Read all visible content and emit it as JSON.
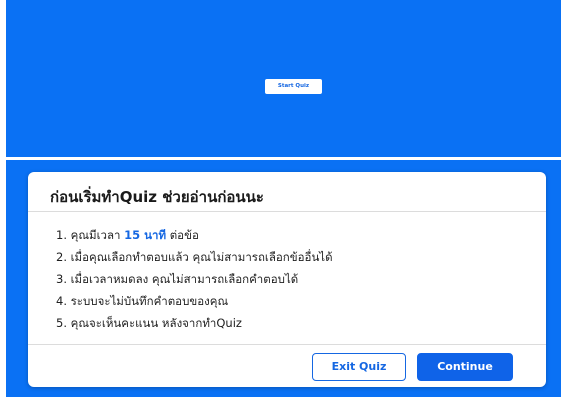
{
  "start_screen": {
    "start_button_label": "Start Quiz"
  },
  "dialog": {
    "title": "ก่อนเริ่มทำQuiz ช่วยอ่านก่อนนะ",
    "rules": [
      {
        "prefix": "1. คุณมีเวลา ",
        "highlight": "15 นาที",
        "suffix": " ต่อข้อ"
      },
      {
        "text": "2. เมื่อคุณเลือกทำตอบแล้ว คุณไม่สามารถเลือกข้ออื่นได้"
      },
      {
        "text": "3. เมื่อเวลาหมดลง คุณไม่สามารถเลือกคำตอบได้"
      },
      {
        "text": "4. ระบบจะไม่บันทึกคำตอบของคุณ"
      },
      {
        "text": "5. คุณจะเห็นคะแนน หลังจากทำQuiz"
      }
    ],
    "exit_button_label": "Exit Quiz",
    "continue_button_label": "Continue"
  },
  "colors": {
    "background_blue": "#0a71f4",
    "accent_blue": "#1567e2",
    "continue_blue": "#0f63e8"
  }
}
